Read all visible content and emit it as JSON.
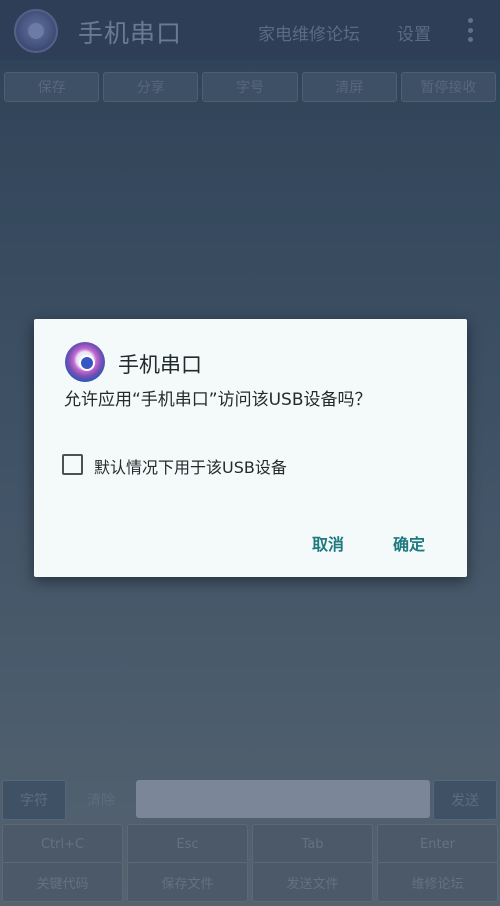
{
  "app": {
    "title": "手机串口",
    "header_links": [
      "家电维修论坛",
      "设置"
    ]
  },
  "toolbar": {
    "buttons": [
      "保存",
      "分享",
      "字号",
      "清屏",
      "暂停接收"
    ]
  },
  "send": {
    "mode_label": "字符",
    "clear_label": "清除",
    "send_label": "发送"
  },
  "keys": [
    "Ctrl+C",
    "Esc",
    "Tab",
    "Enter"
  ],
  "functions": [
    "关键代码",
    "保存文件",
    "发送文件",
    "维修论坛"
  ],
  "dialog": {
    "title": "手机串口",
    "message": "允许应用“手机串口”访问该USB设备吗？",
    "checkbox_label": "默认情况下用于该USB设备",
    "checkbox_checked": false,
    "cancel_label": "取消",
    "ok_label": "确定"
  },
  "colors": {
    "dialog_background": "#f4fafa",
    "dialog_accent": "#1f7a80",
    "header_background": "#2e3e57"
  }
}
